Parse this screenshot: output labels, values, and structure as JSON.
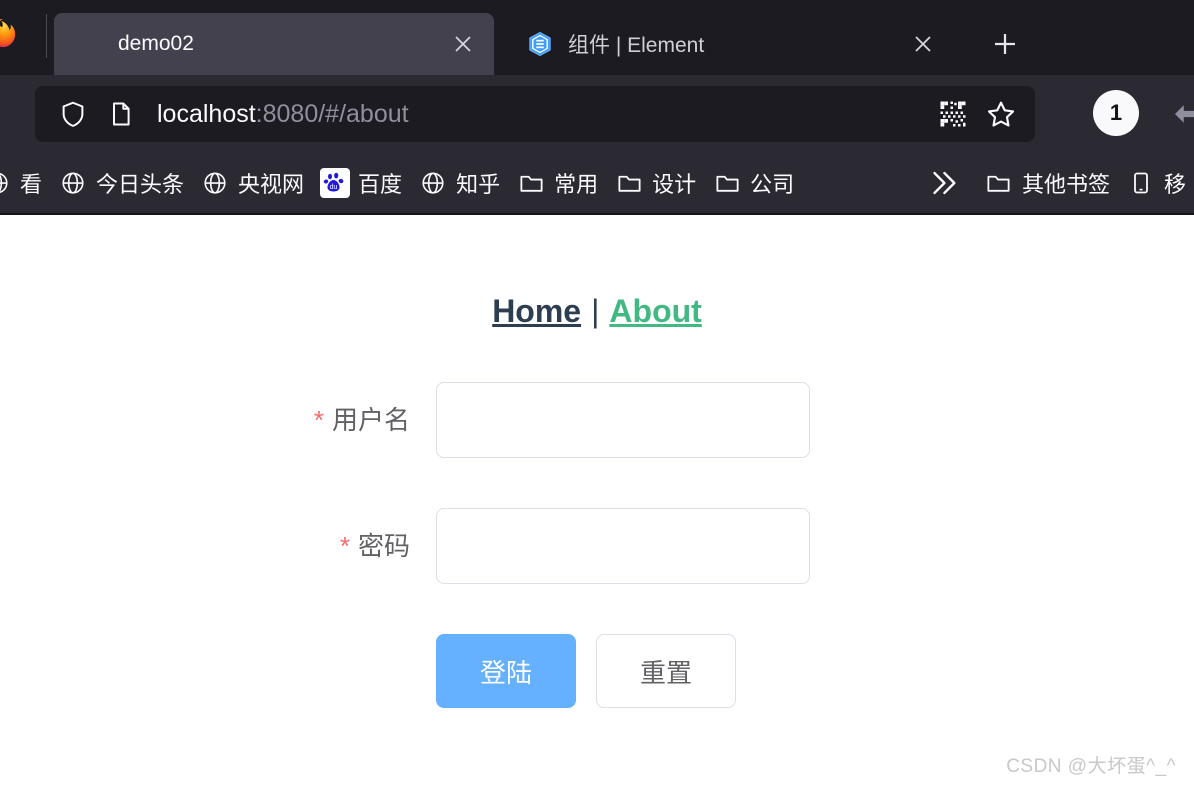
{
  "browser": {
    "app": "firefox",
    "tabs": [
      {
        "title": "demo02",
        "favicon": "blank-page-icon",
        "active": true,
        "close_label": "×"
      },
      {
        "title": "组件 | Element",
        "favicon": "element-ui-icon",
        "active": false,
        "close_label": "×"
      }
    ],
    "new_tab_label": "+",
    "urlbar": {
      "shield_icon": "shield-icon",
      "page_icon": "page-icon",
      "host": "localhost",
      "path": ":8080/#/about",
      "qr_icon": "qr-code-icon",
      "bookmark_icon": "star-icon"
    },
    "container_badge": "1",
    "overflow_arrow_icon": "arrow-left-icon",
    "bookmarks": [
      {
        "label": "看",
        "icon": "globe-icon",
        "clipped": true
      },
      {
        "label": "今日头条",
        "icon": "globe-icon"
      },
      {
        "label": "央视网",
        "icon": "globe-icon"
      },
      {
        "label": "百度",
        "icon": "baidu-icon"
      },
      {
        "label": "知乎",
        "icon": "globe-icon"
      },
      {
        "label": "常用",
        "icon": "folder-icon"
      },
      {
        "label": "设计",
        "icon": "folder-icon"
      },
      {
        "label": "公司",
        "icon": "folder-icon"
      }
    ],
    "bookmarks_overflow_icon": "double-chevron-right-icon",
    "bookmarks_right": [
      {
        "label": "其他书签",
        "icon": "folder-icon"
      },
      {
        "label": "移",
        "icon": "mobile-icon",
        "clipped": true
      }
    ]
  },
  "page": {
    "nav": {
      "home_label": "Home",
      "separator": "|",
      "about_label": "About",
      "active": "About"
    },
    "form": {
      "fields": [
        {
          "label": "用户名",
          "required": true,
          "star": "*",
          "value": "",
          "placeholder": ""
        },
        {
          "label": "密码",
          "required": true,
          "star": "*",
          "value": "",
          "placeholder": ""
        }
      ],
      "submit_label": "登陆",
      "reset_label": "重置"
    },
    "watermark": "CSDN @大坏蛋^_^"
  },
  "colors": {
    "chrome_bg": "#2b2a33",
    "tabstrip_bg": "#1c1b22",
    "active_tab": "#42414d",
    "accent_green": "#42b983",
    "nav_dark": "#2c3e50",
    "primary_blue": "#66b1ff",
    "required_red": "#f56c6c",
    "input_border": "#dcdfe6"
  }
}
